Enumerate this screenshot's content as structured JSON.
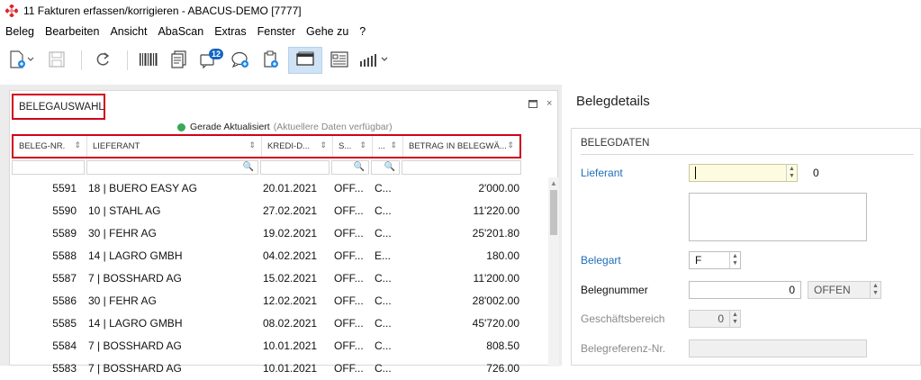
{
  "window": {
    "title": "11 Fakturen erfassen/korrigieren - ABACUS-DEMO [7777]"
  },
  "menu": [
    "Beleg",
    "Bearbeiten",
    "Ansicht",
    "AbaScan",
    "Extras",
    "Fenster",
    "Gehe zu",
    "?"
  ],
  "toolbar": {
    "badge_count": "12"
  },
  "left_panel": {
    "title": "BELEGAUSWAHL",
    "refresh_status": "Gerade Aktualisiert",
    "refresh_hint": "(Aktuellere Daten verfügbar)",
    "columns": [
      "BELEG-NR.",
      "LIEFERANT",
      "KREDI-D...",
      "S...",
      "...",
      "BETRAG IN BELEGWÄ..."
    ],
    "rows": [
      [
        "5591",
        "18 | BUERO EASY AG",
        "20.01.2021",
        "OFF...",
        "C...",
        "2'000.00"
      ],
      [
        "5590",
        "10 | STAHL AG",
        "27.02.2021",
        "OFF...",
        "C...",
        "11'220.00"
      ],
      [
        "5589",
        "30 | FEHR AG",
        "19.02.2021",
        "OFF...",
        "C...",
        "25'201.80"
      ],
      [
        "5588",
        "14 | LAGRO GMBH",
        "04.02.2021",
        "OFF...",
        "E...",
        "180.00"
      ],
      [
        "5587",
        "7 | BOSSHARD AG",
        "15.02.2021",
        "OFF...",
        "C...",
        "11'200.00"
      ],
      [
        "5586",
        "30 | FEHR AG",
        "12.02.2021",
        "OFF...",
        "C...",
        "28'002.00"
      ],
      [
        "5585",
        "14 | LAGRO GMBH",
        "08.02.2021",
        "OFF...",
        "C...",
        "45'720.00"
      ],
      [
        "5584",
        "7 | BOSSHARD AG",
        "10.01.2021",
        "OFF...",
        "C...",
        "808.50"
      ],
      [
        "5583",
        "7 | BOSSHARD AG",
        "10.01.2021",
        "OFF...",
        "C...",
        "726.00"
      ]
    ]
  },
  "right_panel": {
    "title": "Belegdetails",
    "section": "BELEGDATEN",
    "fields": {
      "lieferant_label": "Lieferant",
      "lieferant_suffix": "0",
      "belegart_label": "Belegart",
      "belegart_value": "F",
      "belegnummer_label": "Belegnummer",
      "belegnummer_value": "0",
      "status_value": "OFFEN",
      "geschaeftsbereich_label": "Geschäftsbereich",
      "geschaeftsbereich_value": "0",
      "belegreferenz_label": "Belegreferenz-Nr."
    }
  },
  "colors": {
    "highlight_border": "#d0021b",
    "link_blue": "#1f6eb8",
    "active_tool": "#cfe3f5"
  }
}
